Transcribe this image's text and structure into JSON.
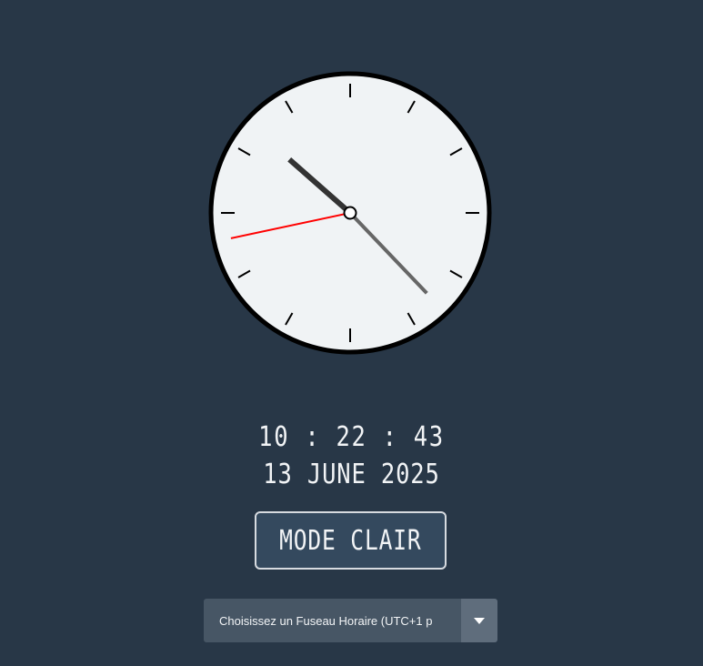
{
  "clock": {
    "hour": 10,
    "minute": 22,
    "second": 43,
    "face_color": "#f0f3f5",
    "border_color": "#000000",
    "hour_hand_color": "#333333",
    "minute_hand_color": "#666666",
    "second_hand_color": "#ff0000"
  },
  "digital": {
    "time": "10 : 22 : 43",
    "date": "13 JUNE 2025"
  },
  "mode_button": {
    "label": "MODE CLAIR"
  },
  "timezone": {
    "selected": "Choisissez un Fuseau Horaire (UTC+1 p",
    "arrow_icon": "caret-down-icon"
  },
  "theme": {
    "background": "#283747",
    "text": "#f2f4f6"
  }
}
